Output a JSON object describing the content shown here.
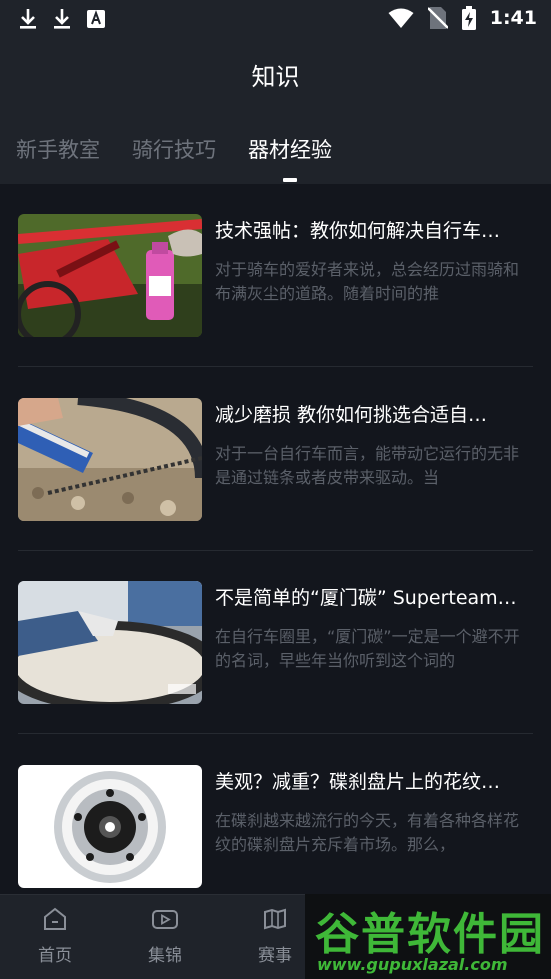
{
  "status_bar": {
    "time": "1:41",
    "icons": [
      "download-icon",
      "download-icon",
      "font-a-icon",
      "wifi-icon",
      "no-sim-icon",
      "battery-charging-icon"
    ]
  },
  "header": {
    "title": "知识",
    "tabs": [
      {
        "label": "新手教室",
        "active": false
      },
      {
        "label": "骑行技巧",
        "active": false
      },
      {
        "label": "器材经验",
        "active": true
      }
    ]
  },
  "articles": [
    {
      "title": "技术强帖：教你如何解决自行车…",
      "desc": "对于骑车的爱好者来说，总会经历过雨骑和布满灰尘的道路。随着时间的推"
    },
    {
      "title": "减少磨损 教你如何挑选合适自…",
      "desc": "对于一台自行车而言，能带动它运行的无非是通过链条或者皮带来驱动。当"
    },
    {
      "title": "不是简单的“厦门碳” Superteam…",
      "desc": "在自行车圈里，“厦门碳”一定是一个避不开的名词，早些年当你听到这个词的"
    },
    {
      "title": "美观？减重？碟刹盘片上的花纹…",
      "desc": "在碟刹越来越流行的今天，有着各种各样花纹的碟刹盘片充斥着市场。那么，"
    }
  ],
  "bottom_nav": [
    {
      "label": "首页",
      "icon": "home-icon"
    },
    {
      "label": "集锦",
      "icon": "video-icon"
    },
    {
      "label": "赛事",
      "icon": "map-icon"
    }
  ],
  "watermark": {
    "brand": "谷普软件园",
    "url": "www.gupuxlazal.com"
  },
  "colors": {
    "background": "#13161d",
    "header": "#1f232a",
    "text_primary": "#ffffff",
    "text_secondary": "#5b6069",
    "tab_inactive": "#6e737c",
    "watermark_green": "#3fb838"
  }
}
